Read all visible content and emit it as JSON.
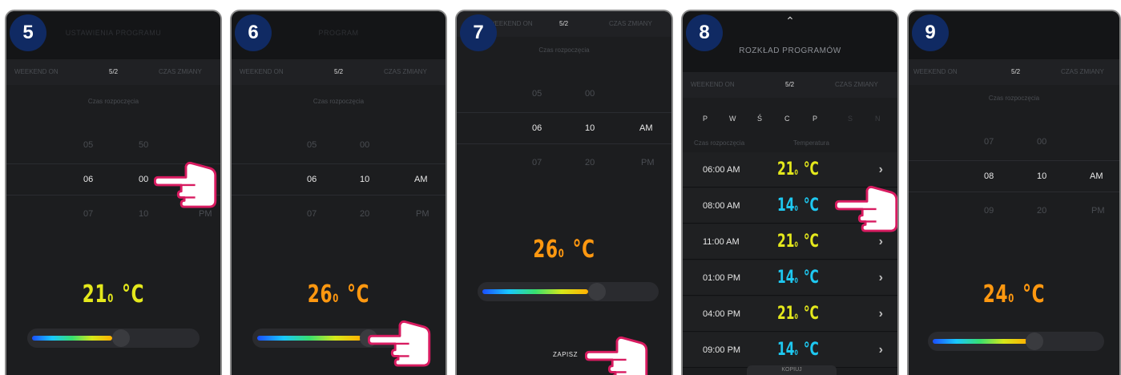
{
  "colors": {
    "badge": "#102a63",
    "temp_yellow": "#e4e81c",
    "temp_orange": "#ff9810",
    "temp_cyan": "#1ec8f0",
    "hand_outline": "#d81b60"
  },
  "panel5": {
    "step": "5",
    "header_title": "USTAWIENIA PROGRAMU",
    "tab_left": "WEEKEND ON",
    "tab_center": "5/2",
    "tab_right": "CZAS ZMIANY",
    "sublabel": "Czas rozpoczęcia",
    "rows": [
      {
        "h": "05",
        "m": "50",
        "ap": ""
      },
      {
        "h": "06",
        "m": "00",
        "ap": ""
      },
      {
        "h": "07",
        "m": "10",
        "ap": "PM"
      }
    ],
    "temp_int": "21",
    "temp_dec": "0",
    "temp_unit": "°C",
    "slider_level": 0.45
  },
  "panel6": {
    "step": "6",
    "header_title": "PROGRAM",
    "tab_left": "WEEKEND ON",
    "tab_center": "5/2",
    "tab_right": "CZAS ZMIANY",
    "sublabel": "Czas rozpoczęcia",
    "rows": [
      {
        "h": "05",
        "m": "00",
        "ap": ""
      },
      {
        "h": "06",
        "m": "10",
        "ap": "AM"
      },
      {
        "h": "07",
        "m": "20",
        "ap": "PM"
      }
    ],
    "temp_int": "26",
    "temp_dec": "0",
    "temp_unit": "°C",
    "slider_level": 0.6
  },
  "panel7": {
    "step": "7",
    "tab_left": "WEEKEND ON",
    "tab_center": "5/2",
    "tab_right": "CZAS ZMIANY",
    "sublabel": "Czas rozpoczęcia",
    "rows": [
      {
        "h": "05",
        "m": "00",
        "ap": ""
      },
      {
        "h": "06",
        "m": "10",
        "ap": "AM"
      },
      {
        "h": "07",
        "m": "20",
        "ap": "PM"
      }
    ],
    "temp_int": "26",
    "temp_dec": "0",
    "temp_unit": "°C",
    "slider_level": 0.6,
    "save_label": "ZAPISZ"
  },
  "panel8": {
    "step": "8",
    "header_title": "ROZKŁAD PROGRAMÓW",
    "tab_left": "WEEKEND ON",
    "tab_center": "5/2",
    "tab_right": "CZAS ZMIANY",
    "days": [
      "P",
      "W",
      "Ś",
      "C",
      "P",
      "S",
      "N"
    ],
    "col_start": "Czas rozpoczęcia",
    "col_temp": "Temperatura",
    "schedule": [
      {
        "time": "06:00 AM",
        "int": "21",
        "dec": "0",
        "unit": "°C",
        "tone": "yellow"
      },
      {
        "time": "08:00 AM",
        "int": "14",
        "dec": "0",
        "unit": "°C",
        "tone": "cyan"
      },
      {
        "time": "11:00 AM",
        "int": "21",
        "dec": "0",
        "unit": "°C",
        "tone": "yellow"
      },
      {
        "time": "01:00 PM",
        "int": "14",
        "dec": "0",
        "unit": "°C",
        "tone": "cyan"
      },
      {
        "time": "04:00 PM",
        "int": "21",
        "dec": "0",
        "unit": "°C",
        "tone": "yellow"
      },
      {
        "time": "09:00 PM",
        "int": "14",
        "dec": "0",
        "unit": "°C",
        "tone": "cyan"
      }
    ],
    "bottom_label": "KOPIUJ"
  },
  "panel9": {
    "step": "9",
    "tab_left": "WEEKEND ON",
    "tab_center": "5/2",
    "tab_right": "CZAS ZMIANY",
    "sublabel": "Czas rozpoczęcia",
    "rows": [
      {
        "h": "07",
        "m": "00",
        "ap": ""
      },
      {
        "h": "08",
        "m": "10",
        "ap": "AM"
      },
      {
        "h": "09",
        "m": "20",
        "ap": "PM"
      }
    ],
    "temp_int": "24",
    "temp_dec": "0",
    "temp_unit": "°C",
    "slider_level": 0.52
  }
}
